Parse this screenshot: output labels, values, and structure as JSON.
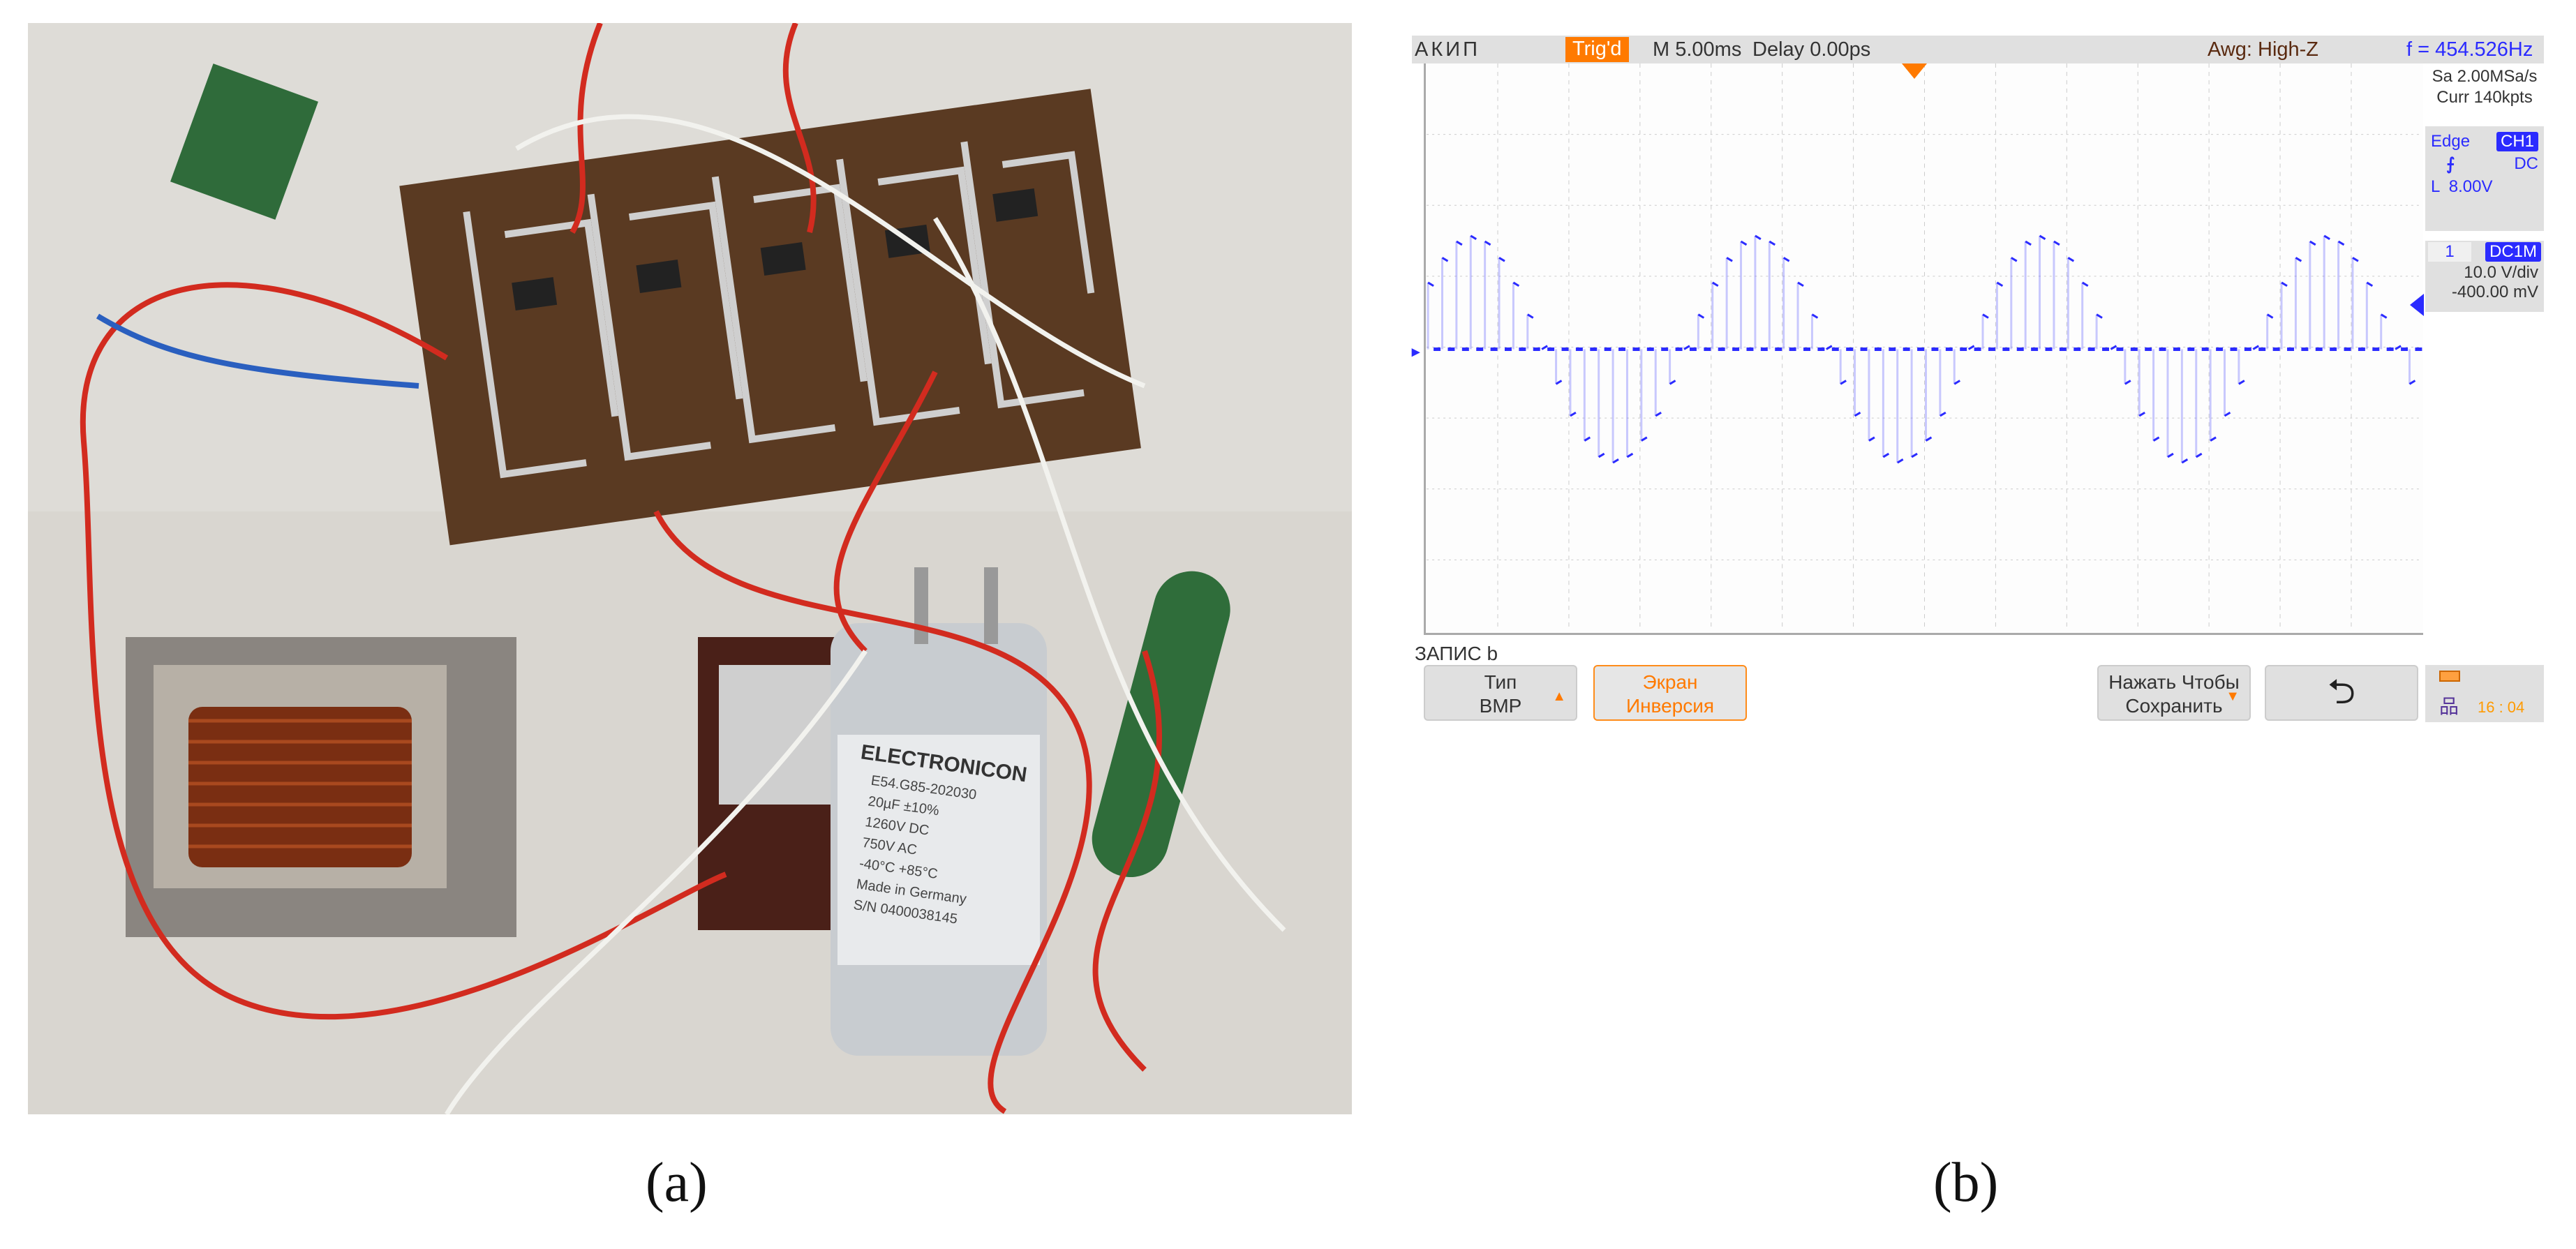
{
  "captions": {
    "a": "(a)",
    "b": "(b)"
  },
  "photo": {
    "capacitor_brand": "ELECTRONICON",
    "capacitor_lines": [
      "E54.G85-202030",
      "20µF ±10%",
      "1260V DC",
      "750V AC",
      "-40°C +85°C",
      "Made in Germany",
      "S/N 0400038145"
    ]
  },
  "scope": {
    "brand": "АКИП",
    "trigger_status": "Trig'd",
    "timebase": "M 5.00ms",
    "delay": "Delay 0.00ps",
    "awg": "Awg: High-Z",
    "frequency": "f = 454.526Hz",
    "sample_rate": "Sa 2.00MSa/s",
    "memory": "Curr 140kpts",
    "trigger": {
      "type": "Edge",
      "source": "CH1",
      "coupling": "DC",
      "level": "L  8.00V",
      "slope_icon": "rising-edge-icon"
    },
    "channel": {
      "number": "1",
      "coupling": "DC1M",
      "scale": "10.0 V/div",
      "offset": "-400.00 mV"
    },
    "menu_title": "ЗАПИС b",
    "buttons": [
      {
        "line1": "Тип",
        "line2": "BMP",
        "arrow": "▲"
      },
      {
        "line1": "Экран",
        "line2": "Инверсия"
      },
      {
        "line1": "Нажать Чтобы",
        "line2": "Сохранить",
        "arrow": "▼"
      }
    ],
    "back_icon": "return-arrow-icon",
    "clock": "16 : 04",
    "colors": {
      "trace": "#2b2bff",
      "accent": "#ff7a00",
      "panel": "#e0e0e0"
    }
  },
  "chart_data": {
    "type": "line",
    "description_units": "volts vs milliseconds",
    "x_unit": "ms",
    "y_unit": "V",
    "x_divisions": 14,
    "y_divisions": 8,
    "time_per_div_ms": 5,
    "volts_per_div": 10,
    "xlim": [
      0,
      70
    ],
    "ylim": [
      -40,
      40
    ],
    "grid": true,
    "pulse_period_ms": 1,
    "fundamental_period_ms": 20,
    "envelope_peak_v": [
      0,
      4.9,
      9.4,
      12.9,
      15.2,
      16,
      15.2,
      12.9,
      9.4,
      4.9,
      0,
      -4.9,
      -9.4,
      -12.9,
      -15.2,
      -16,
      -15.2,
      -12.9,
      -9.4,
      -4.9
    ]
  }
}
